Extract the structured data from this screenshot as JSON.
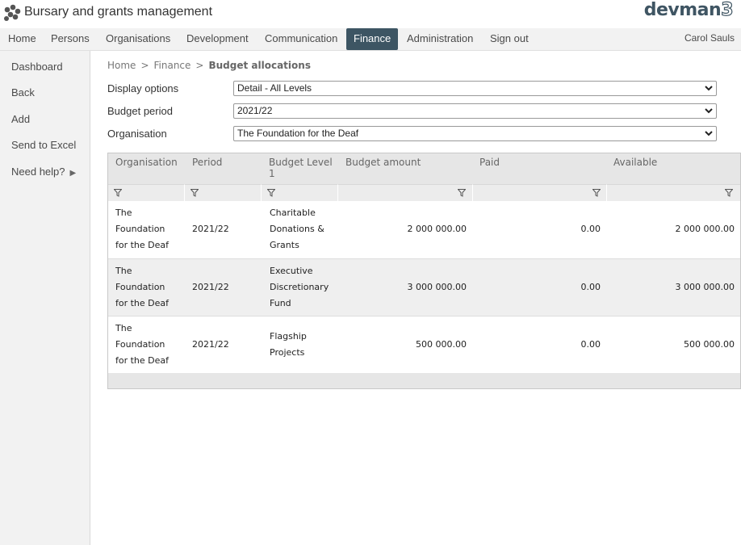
{
  "header": {
    "app_title": "Bursary and grants management",
    "brand_main": "devman",
    "brand_suffix": "3"
  },
  "nav": {
    "items": [
      "Home",
      "Persons",
      "Organisations",
      "Development",
      "Communication",
      "Finance",
      "Administration",
      "Sign out"
    ],
    "active": "Finance",
    "user": "Carol Sauls"
  },
  "sidebar": {
    "items": [
      "Dashboard",
      "Back",
      "Add",
      "Send to Excel",
      "Need help?"
    ],
    "help_arrow": "▶"
  },
  "breadcrumb": {
    "home": "Home",
    "section": "Finance",
    "current": "Budget allocations",
    "separator": ">"
  },
  "form": {
    "display_options_label": "Display options",
    "display_options_value": "Detail - All Levels",
    "budget_period_label": "Budget period",
    "budget_period_value": "2021/22",
    "organisation_label": "Organisation",
    "organisation_value": "The Foundation for the Deaf"
  },
  "grid": {
    "columns": {
      "organisation": "Organisation",
      "period": "Period",
      "budget_level_1": "Budget Level",
      "budget_level_2": "1",
      "budget_amount": "Budget amount",
      "paid": "Paid",
      "available": "Available"
    },
    "rows": [
      {
        "org_1": "The",
        "org_2": "Foundation",
        "org_3": "for the Deaf",
        "period": "2021/22",
        "level_1": "Charitable",
        "level_2": "Donations &",
        "level_3": "Grants",
        "budget": "2 000 000.00",
        "paid": "0.00",
        "available": "2 000 000.00"
      },
      {
        "org_1": "The",
        "org_2": "Foundation",
        "org_3": "for the Deaf",
        "period": "2021/22",
        "level_1": "Executive",
        "level_2": "Discretionary",
        "level_3": "Fund",
        "budget": "3 000 000.00",
        "paid": "0.00",
        "available": "3 000 000.00"
      },
      {
        "org_1": "The",
        "org_2": "Foundation",
        "org_3": "for the Deaf",
        "period": "2021/22",
        "level_1": "Flagship",
        "level_2": "Projects",
        "level_3": "",
        "budget": "500 000.00",
        "paid": "0.00",
        "available": "500 000.00"
      }
    ]
  },
  "colors": {
    "nav_active_bg": "#3d5563",
    "brand": "#3f5563"
  },
  "icons": {
    "logo": "paw-cluster-icon",
    "filter": "filter-funnel-icon",
    "dropdown": "chevron-down-icon",
    "help_arrow": "triangle-right-icon"
  }
}
